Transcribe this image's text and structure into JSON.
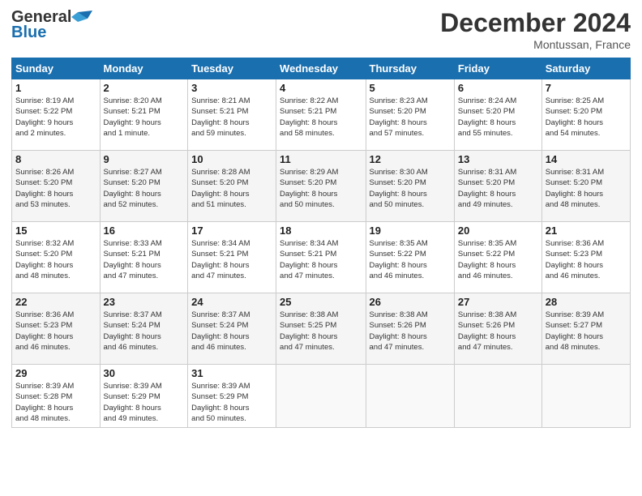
{
  "header": {
    "logo_line1": "General",
    "logo_line2": "Blue",
    "month_title": "December 2024",
    "location": "Montussan, France"
  },
  "weekdays": [
    "Sunday",
    "Monday",
    "Tuesday",
    "Wednesday",
    "Thursday",
    "Friday",
    "Saturday"
  ],
  "weeks": [
    [
      {
        "day": "1",
        "info": "Sunrise: 8:19 AM\nSunset: 5:22 PM\nDaylight: 9 hours\nand 2 minutes."
      },
      {
        "day": "2",
        "info": "Sunrise: 8:20 AM\nSunset: 5:21 PM\nDaylight: 9 hours\nand 1 minute."
      },
      {
        "day": "3",
        "info": "Sunrise: 8:21 AM\nSunset: 5:21 PM\nDaylight: 8 hours\nand 59 minutes."
      },
      {
        "day": "4",
        "info": "Sunrise: 8:22 AM\nSunset: 5:21 PM\nDaylight: 8 hours\nand 58 minutes."
      },
      {
        "day": "5",
        "info": "Sunrise: 8:23 AM\nSunset: 5:20 PM\nDaylight: 8 hours\nand 57 minutes."
      },
      {
        "day": "6",
        "info": "Sunrise: 8:24 AM\nSunset: 5:20 PM\nDaylight: 8 hours\nand 55 minutes."
      },
      {
        "day": "7",
        "info": "Sunrise: 8:25 AM\nSunset: 5:20 PM\nDaylight: 8 hours\nand 54 minutes."
      }
    ],
    [
      {
        "day": "8",
        "info": "Sunrise: 8:26 AM\nSunset: 5:20 PM\nDaylight: 8 hours\nand 53 minutes."
      },
      {
        "day": "9",
        "info": "Sunrise: 8:27 AM\nSunset: 5:20 PM\nDaylight: 8 hours\nand 52 minutes."
      },
      {
        "day": "10",
        "info": "Sunrise: 8:28 AM\nSunset: 5:20 PM\nDaylight: 8 hours\nand 51 minutes."
      },
      {
        "day": "11",
        "info": "Sunrise: 8:29 AM\nSunset: 5:20 PM\nDaylight: 8 hours\nand 50 minutes."
      },
      {
        "day": "12",
        "info": "Sunrise: 8:30 AM\nSunset: 5:20 PM\nDaylight: 8 hours\nand 50 minutes."
      },
      {
        "day": "13",
        "info": "Sunrise: 8:31 AM\nSunset: 5:20 PM\nDaylight: 8 hours\nand 49 minutes."
      },
      {
        "day": "14",
        "info": "Sunrise: 8:31 AM\nSunset: 5:20 PM\nDaylight: 8 hours\nand 48 minutes."
      }
    ],
    [
      {
        "day": "15",
        "info": "Sunrise: 8:32 AM\nSunset: 5:20 PM\nDaylight: 8 hours\nand 48 minutes."
      },
      {
        "day": "16",
        "info": "Sunrise: 8:33 AM\nSunset: 5:21 PM\nDaylight: 8 hours\nand 47 minutes."
      },
      {
        "day": "17",
        "info": "Sunrise: 8:34 AM\nSunset: 5:21 PM\nDaylight: 8 hours\nand 47 minutes."
      },
      {
        "day": "18",
        "info": "Sunrise: 8:34 AM\nSunset: 5:21 PM\nDaylight: 8 hours\nand 47 minutes."
      },
      {
        "day": "19",
        "info": "Sunrise: 8:35 AM\nSunset: 5:22 PM\nDaylight: 8 hours\nand 46 minutes."
      },
      {
        "day": "20",
        "info": "Sunrise: 8:35 AM\nSunset: 5:22 PM\nDaylight: 8 hours\nand 46 minutes."
      },
      {
        "day": "21",
        "info": "Sunrise: 8:36 AM\nSunset: 5:23 PM\nDaylight: 8 hours\nand 46 minutes."
      }
    ],
    [
      {
        "day": "22",
        "info": "Sunrise: 8:36 AM\nSunset: 5:23 PM\nDaylight: 8 hours\nand 46 minutes."
      },
      {
        "day": "23",
        "info": "Sunrise: 8:37 AM\nSunset: 5:24 PM\nDaylight: 8 hours\nand 46 minutes."
      },
      {
        "day": "24",
        "info": "Sunrise: 8:37 AM\nSunset: 5:24 PM\nDaylight: 8 hours\nand 46 minutes."
      },
      {
        "day": "25",
        "info": "Sunrise: 8:38 AM\nSunset: 5:25 PM\nDaylight: 8 hours\nand 47 minutes."
      },
      {
        "day": "26",
        "info": "Sunrise: 8:38 AM\nSunset: 5:26 PM\nDaylight: 8 hours\nand 47 minutes."
      },
      {
        "day": "27",
        "info": "Sunrise: 8:38 AM\nSunset: 5:26 PM\nDaylight: 8 hours\nand 47 minutes."
      },
      {
        "day": "28",
        "info": "Sunrise: 8:39 AM\nSunset: 5:27 PM\nDaylight: 8 hours\nand 48 minutes."
      }
    ],
    [
      {
        "day": "29",
        "info": "Sunrise: 8:39 AM\nSunset: 5:28 PM\nDaylight: 8 hours\nand 48 minutes."
      },
      {
        "day": "30",
        "info": "Sunrise: 8:39 AM\nSunset: 5:29 PM\nDaylight: 8 hours\nand 49 minutes."
      },
      {
        "day": "31",
        "info": "Sunrise: 8:39 AM\nSunset: 5:29 PM\nDaylight: 8 hours\nand 50 minutes."
      },
      null,
      null,
      null,
      null
    ]
  ]
}
